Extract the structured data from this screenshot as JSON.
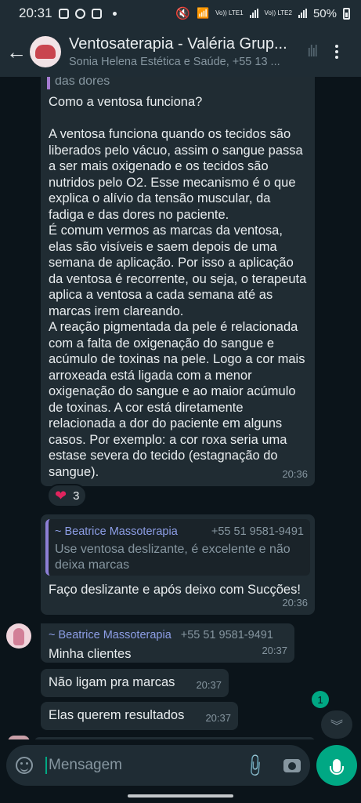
{
  "status_bar": {
    "time": "20:31",
    "battery": "50%",
    "network_1": "Vo)) LTE1",
    "network_2": "Vo)) LTE2"
  },
  "header": {
    "back_icon": "arrow-left-icon",
    "title": "Ventosaterapia - Valéria Grup...",
    "subtitle": "Sonia Helena Estética e Saúde, +55 13 ..."
  },
  "messages": {
    "big": {
      "quoted_tail": "das dores",
      "text": "Como a ventosa funciona?\n\nA ventosa funciona quando os tecidos são liberados pelo vácuo, assim o sangue passa a ser mais oxigenado e os tecidos são nutridos pelo O2. Esse mecanismo é o que explica o alívio da tensão muscular, da fadiga e das dores no paciente.\nÉ comum vermos as marcas da ventosa, elas são visíveis e saem depois de uma semana de aplicação. Por isso a aplicação da ventosa é recorrente, ou seja, o terapeuta aplica a ventosa a cada semana até as marcas irem clareando.\nA reação pigmentada da pele é relacionada com a falta de oxigenação do sangue e acúmulo de toxinas na pele. Logo a cor mais arroxeada está ligada com a menor oxigenação do sangue e ao maior acúmulo de toxinas. A cor está diretamente relacionada a dor do paciente em alguns casos. Por exemplo: a cor roxa seria uma estase severa do tecido (estagnação do sangue).",
      "time": "20:36",
      "reaction_emoji": "❤️",
      "reaction_count": "3"
    },
    "reply": {
      "quote_name": "~ Beatrice Massoterapia",
      "quote_phone": "+55 51 9581-9491",
      "quote_text": "Use ventosa deslizante, é excelente e não deixa marcas",
      "text": "Faço deslizante e após deixo com Sucções!",
      "time": "20:36"
    },
    "m1": {
      "sender_name": "~ Beatrice Massoterapia",
      "sender_phone": "+55 51 9581-9491",
      "text": "Minha clientes",
      "time": "20:37"
    },
    "m2": {
      "text": "Não ligam pra marcas",
      "time": "20:37"
    },
    "m3": {
      "text": "Elas querem resultados",
      "time": "20:37"
    }
  },
  "unread_badge": "1",
  "input": {
    "placeholder": "Mensagem"
  },
  "colors": {
    "background": "#0b141a",
    "bubble": "#202c33",
    "accent": "#00a884"
  }
}
